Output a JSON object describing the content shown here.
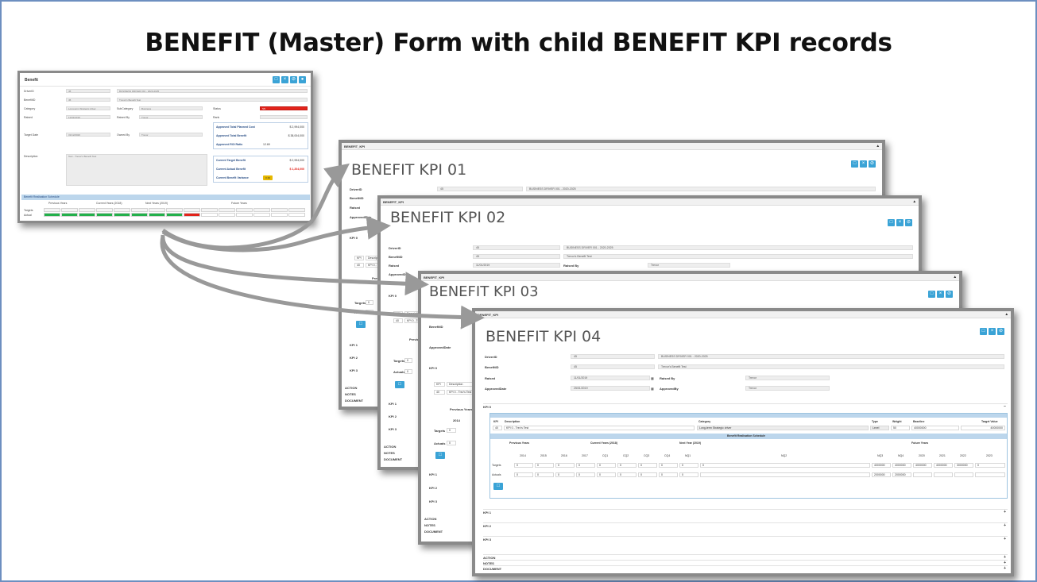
{
  "title": "BENEFIT (Master) Form with child BENEFIT KPI records",
  "colors": {
    "accent": "#3aa3d6",
    "frame": "#6d8fc0",
    "red": "#e2231a",
    "green": "#22b04a",
    "schedule_header": "#bcd6ec"
  },
  "master": {
    "title": "Benefit",
    "fields": {
      "driver_id_label": "DriverID",
      "driver_id": "45",
      "driver_name": "BUSINESS DRIVER 001 - 2020-2025",
      "benefit_id_label": "BenefitID",
      "benefit_id": "45",
      "benefit_name": "Trevor's Benefit Test",
      "category_label": "Category",
      "category": "Long-term Strategic driver",
      "subcategory_label": "SubCategory",
      "subcategory": "Business",
      "raised_label": "Raised",
      "raised": "11/01/2019",
      "raised_by_label": "Raised By",
      "raised_by": "Trevor",
      "target_date_label": "Target Date",
      "target_date": "31/12/2020",
      "owned_by_label": "Owned By",
      "owned_by": "Trevor",
      "status_label": "Status",
      "status": "SN",
      "rank_label": "Rank",
      "description_label": "Description",
      "description": "Test - Trevor's Benefit Test"
    },
    "stats": [
      {
        "label": "Approved Total Planned Cost",
        "value": "$ 2,994,000"
      },
      {
        "label": "Approved Total Benefit",
        "value": "$ 38,004,000"
      },
      {
        "label": "Approved ROI Ratio",
        "value": "12.69"
      }
    ],
    "current": [
      {
        "label": "Current Target Benefit",
        "value": "$ 2,994,000"
      },
      {
        "label": "Current Actual Benefit",
        "value": "$ 1,204,000"
      },
      {
        "label": "Current Benefit Variance",
        "value": "0.39"
      }
    ],
    "schedule_label": "Benefit Realisation Schedule",
    "schedule_groups": [
      "Previous Years",
      "Current Years (2018)",
      "Next Years (2019)",
      "Future Years"
    ],
    "row_labels": [
      "Targets",
      "Actual"
    ]
  },
  "kpi_cards": [
    {
      "strip": "BENEFIT_KPI",
      "title": "BENEFIT KPI 01"
    },
    {
      "strip": "BENEFIT_KPI",
      "title": "BENEFIT KPI 02"
    },
    {
      "strip": "BENEFIT_KPI",
      "title": "BENEFIT KPI 03"
    },
    {
      "strip": "BENEFIT_KPI",
      "title": "BENEFIT KPI 04"
    }
  ],
  "kpi_form": {
    "driver_id_label": "DriverID",
    "driver_id": "45",
    "driver_name": "BUSINESS DRIVER 001 - 2020-2025",
    "benefit_id_label": "BenefitID",
    "benefit_id": "45",
    "benefit_name": "Trevor's Benefit Test",
    "raised_label": "Raised",
    "raised": "11/01/2019",
    "raised_by_label": "Raised By",
    "raised_by": "Trevor",
    "approved_date_label": "ApprovedDate",
    "approved_date": "25/01/2019",
    "approved_by_label": "ApprovedBy",
    "approved_by": "Trevor"
  },
  "kpi0": {
    "label": "KPI 0",
    "headers": {
      "kpi": "KPI",
      "description": "Description",
      "category": "Category",
      "type": "Type",
      "weight": "Weight",
      "baseline": "Baseline",
      "target_value": "Target Value"
    },
    "row": {
      "kpi": "40",
      "description": "KPI 0 - Trev's Test",
      "category": "Long-term Strategic driver",
      "type": "Level",
      "weight": "50",
      "baseline": "40000000",
      "target_value": "40000000"
    },
    "schedule_label": "Benefit Realisation Schedule",
    "groups": {
      "previous": "Previous Years",
      "current": "Current Years (2018)",
      "next": "Next Year (2019)",
      "future": "Future Years"
    },
    "years": [
      "2014",
      "2015",
      "2016",
      "2017",
      "CQ1",
      "CQ2",
      "CQ3",
      "CQ4",
      "NQ1",
      "NQ2",
      "NQ3",
      "NQ4",
      "2020",
      "2021",
      "2022",
      "2023"
    ],
    "targets_label": "Targets",
    "actuals_label": "Actuals",
    "targets": [
      "0",
      "0",
      "0",
      "0",
      "0",
      "0",
      "0",
      "0",
      "0",
      "0",
      "4000000",
      "4000000",
      "4000000",
      "4000000",
      "3000000",
      "0"
    ],
    "actuals": [
      "0",
      "0",
      "0",
      "0",
      "0",
      "0",
      "0",
      "0",
      "0",
      "",
      "2000000",
      "2000000",
      "",
      "",
      "",
      ""
    ]
  },
  "kpi_short": {
    "kpi": "KPI",
    "description": "Description",
    "row_kpi": "40",
    "row_desc": "KPI 0 - Trev's Test",
    "previous": "Previous Years",
    "year": "2014",
    "targets": "Targets",
    "actuals": "Actuals",
    "zero": "0"
  },
  "sections": {
    "kpi1": "KPI 1",
    "kpi2": "KPI 2",
    "kpi3": "KPI 3",
    "action": "ACTION",
    "notes": "NOTES",
    "document": "DOCUMENT"
  }
}
